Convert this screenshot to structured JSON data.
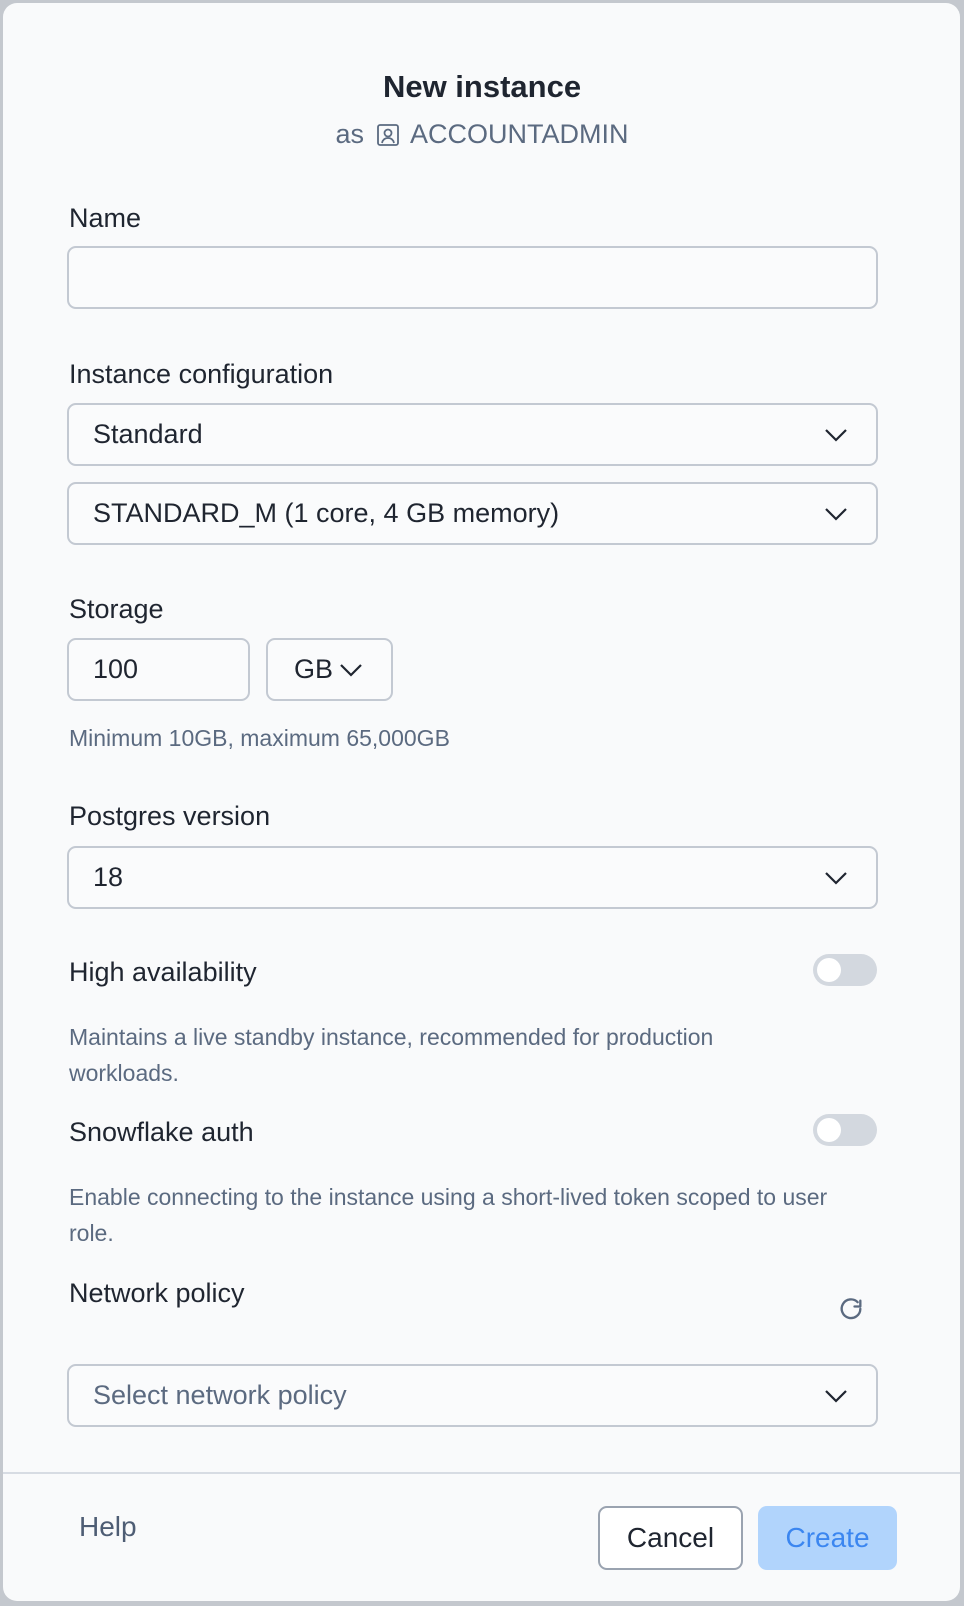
{
  "dialog": {
    "title": "New instance",
    "subtitle_prefix": "as",
    "role": "ACCOUNTADMIN"
  },
  "name_field": {
    "label": "Name",
    "value": ""
  },
  "instance_config": {
    "label": "Instance configuration",
    "family_value": "Standard",
    "size_value": "STANDARD_M (1 core, 4 GB memory)"
  },
  "storage": {
    "label": "Storage",
    "value": "100",
    "unit": "GB",
    "hint": "Minimum 10GB, maximum 65,000GB"
  },
  "postgres": {
    "label": "Postgres version",
    "value": "18"
  },
  "high_availability": {
    "label": "High availability",
    "description": "Maintains a live standby instance, recommended for production workloads.",
    "enabled": false
  },
  "snowflake_auth": {
    "label": "Snowflake auth",
    "description": "Enable connecting to the instance using a short-lived token scoped to user role.",
    "enabled": false
  },
  "network_policy": {
    "label": "Network policy",
    "placeholder": "Select network policy"
  },
  "footer": {
    "help_label": "Help",
    "cancel_label": "Cancel",
    "create_label": "Create"
  },
  "colors": {
    "accent": "#3b86f0",
    "accent_disabled_bg": "#b1d4fc",
    "toggle_off": "#d3d8df"
  }
}
